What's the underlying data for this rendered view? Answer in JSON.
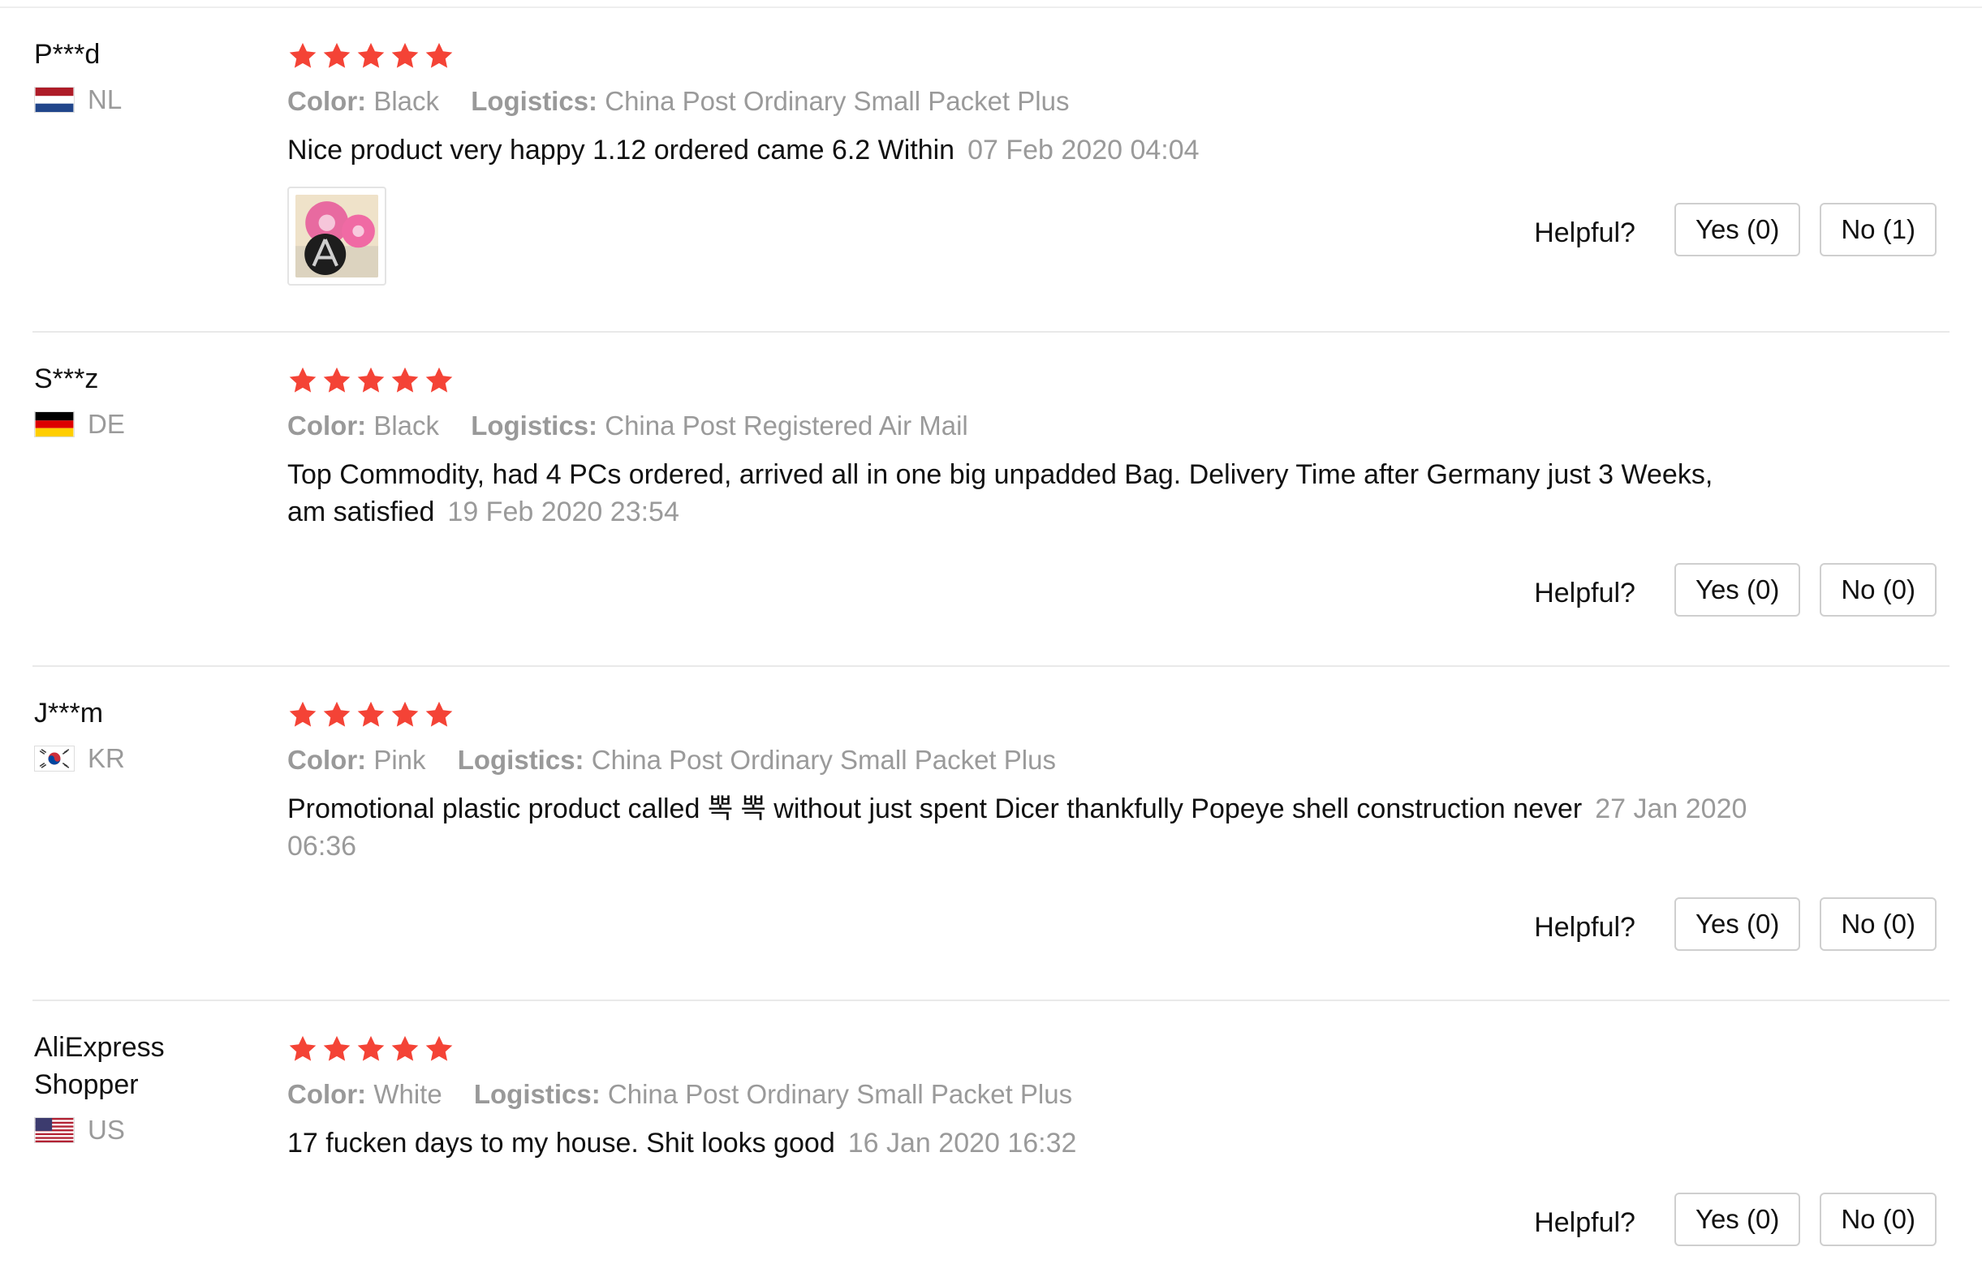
{
  "reviews": [
    {
      "user": "P***d",
      "country": "NL",
      "flag": "netherlands-flag",
      "rating": 5,
      "color_label": "Color:",
      "color": "Black",
      "logistics_label": "Logistics:",
      "logistics": "China Post Ordinary Small Packet Plus",
      "text": "Nice product very happy 1.12 ordered came 6.2 Within",
      "date": "07 Feb 2020 04:04",
      "helpful_label": "Helpful?",
      "yes": "Yes (0)",
      "no": "No (1)"
    },
    {
      "user": "S***z",
      "country": "DE",
      "flag": "germany-flag",
      "rating": 5,
      "color_label": "Color:",
      "color": "Black",
      "logistics_label": "Logistics:",
      "logistics": "China Post Registered Air Mail",
      "text": "Top Commodity, had 4 PCs ordered, arrived all in one big unpadded Bag. Delivery Time after Germany just 3 Weeks, am satisfied",
      "date": "19 Feb 2020 23:54",
      "helpful_label": "Helpful?",
      "yes": "Yes (0)",
      "no": "No (0)"
    },
    {
      "user": "J***m",
      "country": "KR",
      "flag": "south-korea-flag",
      "rating": 5,
      "color_label": "Color:",
      "color": "Pink",
      "logistics_label": "Logistics:",
      "logistics": "China Post Ordinary Small Packet Plus",
      "text": "Promotional plastic product called 뽁 뽁 without just spent Dicer thankfully Popeye shell construction never",
      "date": "27 Jan 2020 06:36",
      "helpful_label": "Helpful?",
      "yes": "Yes (0)",
      "no": "No (0)"
    },
    {
      "user": "AliExpress Shopper",
      "country": "US",
      "flag": "usa-flag",
      "rating": 5,
      "color_label": "Color:",
      "color": "White",
      "logistics_label": "Logistics:",
      "logistics": "China Post Ordinary Small Packet Plus",
      "text": "17 fucken days to my house. Shit looks good",
      "date": "16 Jan 2020 16:32",
      "helpful_label": "Helpful?",
      "yes": "Yes (0)",
      "no": "No (0)"
    }
  ],
  "colors": {
    "star": "#f44336",
    "muted": "#9a9a9a",
    "divider": "#e9e9e9"
  },
  "icons": {
    "star": "star-icon",
    "thumbnail": "review-photo-thumbnail"
  }
}
